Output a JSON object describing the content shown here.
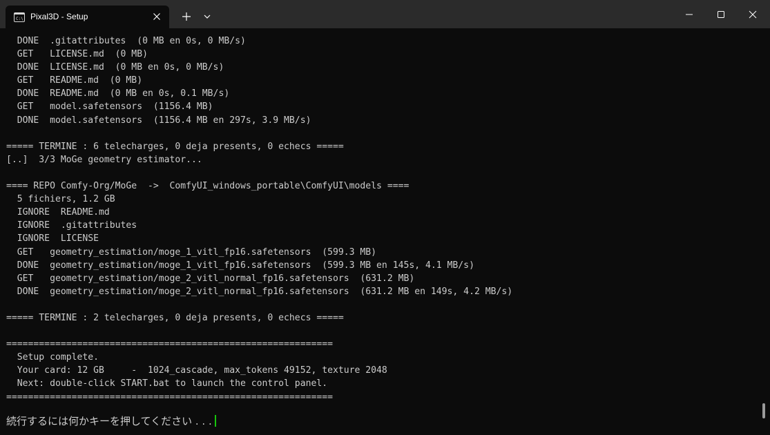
{
  "window": {
    "tab_title": "Pixal3D - Setup",
    "tab_icon": "terminal-icon",
    "controls": {
      "new_tab_icon": "plus-icon",
      "dropdown_icon": "chevron-down-icon",
      "minimize_icon": "minimize-icon",
      "maximize_icon": "maximize-icon",
      "close_icon": "close-icon"
    }
  },
  "terminal": {
    "lines": [
      "  DONE  .gitattributes  (0 MB en 0s, 0 MB/s)",
      "  GET   LICENSE.md  (0 MB)",
      "  DONE  LICENSE.md  (0 MB en 0s, 0 MB/s)",
      "  GET   README.md  (0 MB)",
      "  DONE  README.md  (0 MB en 0s, 0.1 MB/s)",
      "  GET   model.safetensors  (1156.4 MB)",
      "  DONE  model.safetensors  (1156.4 MB en 297s, 3.9 MB/s)",
      "",
      "===== TERMINE : 6 telecharges, 0 deja presents, 0 echecs =====",
      "[..]  3/3 MoGe geometry estimator...",
      "",
      "==== REPO Comfy-Org/MoGe  ->  ComfyUI_windows_portable\\ComfyUI\\models ====",
      "  5 fichiers, 1.2 GB",
      "  IGNORE  README.md",
      "  IGNORE  .gitattributes",
      "  IGNORE  LICENSE",
      "  GET   geometry_estimation/moge_1_vitl_fp16.safetensors  (599.3 MB)",
      "  DONE  geometry_estimation/moge_1_vitl_fp16.safetensors  (599.3 MB en 145s, 4.1 MB/s)",
      "  GET   geometry_estimation/moge_2_vitl_normal_fp16.safetensors  (631.2 MB)",
      "  DONE  geometry_estimation/moge_2_vitl_normal_fp16.safetensors  (631.2 MB en 149s, 4.2 MB/s)",
      "",
      "===== TERMINE : 2 telecharges, 0 deja presents, 0 echecs =====",
      "",
      "============================================================",
      "  Setup complete.",
      "  Your card: 12 GB     -  1024_cascade, max_tokens 49152, texture 2048",
      "  Next: double-click START.bat to launch the control panel.",
      "============================================================"
    ],
    "prompt": "続行するには何かキーを押してください . . .",
    "cursor_color": "#16c60c",
    "text_color": "#cccccc",
    "background_color": "#0c0c0c"
  }
}
